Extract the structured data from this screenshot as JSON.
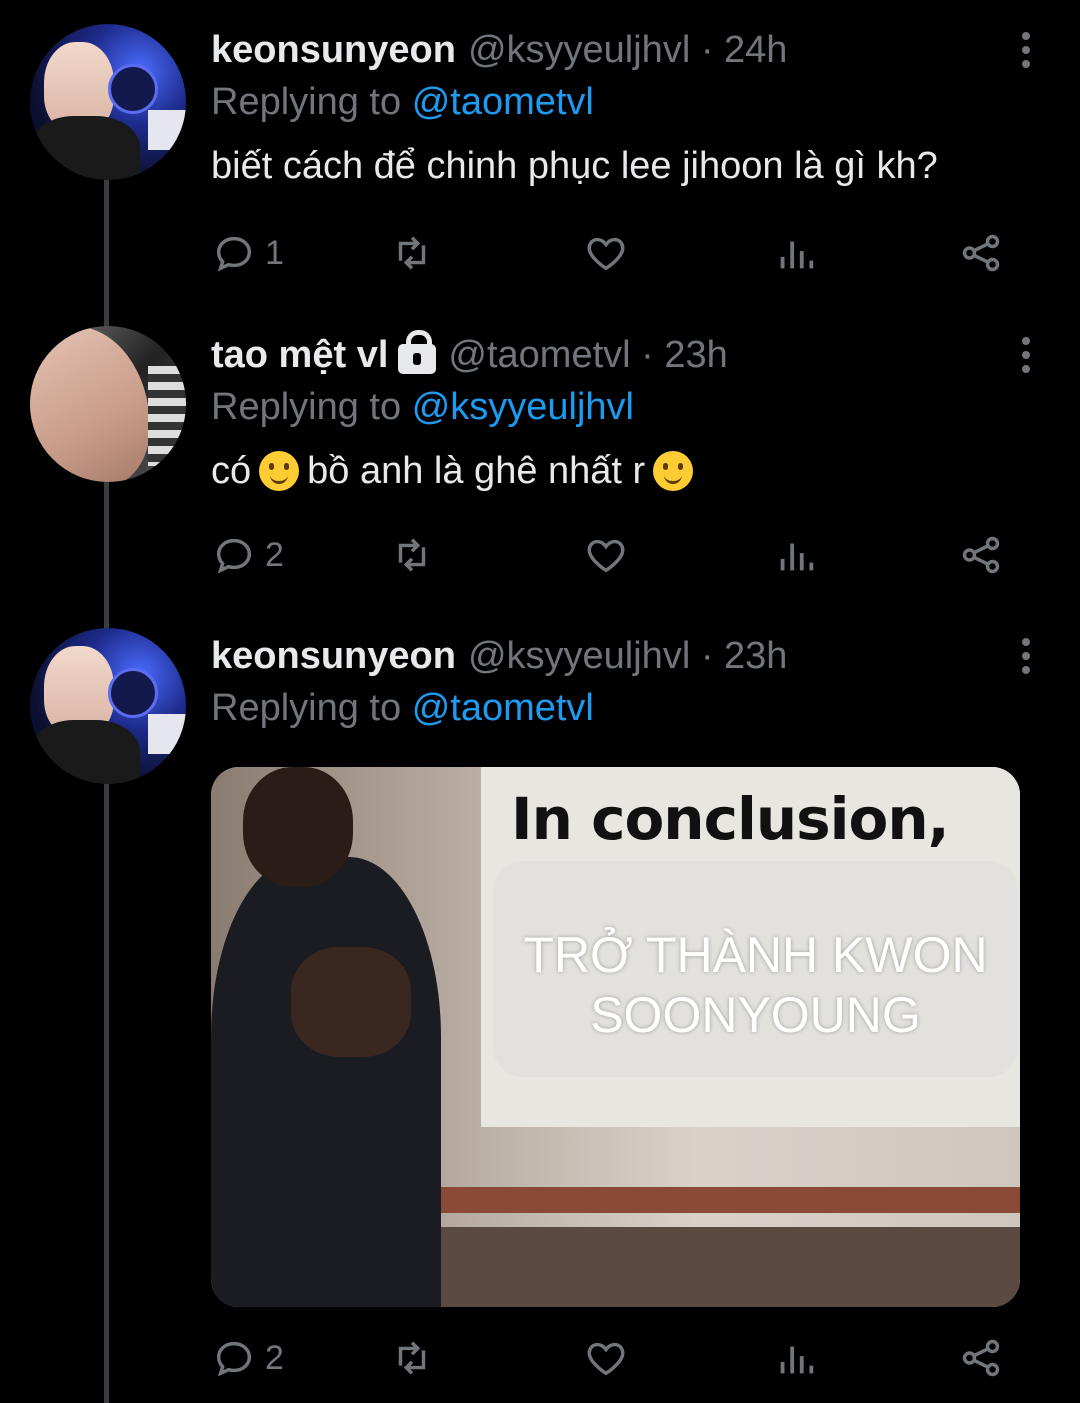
{
  "tweets": [
    {
      "name": "keonsunyeon",
      "handle": "@ksyyeuljhvl · 24h",
      "replying_prefix": "Replying to",
      "replying_to": "@taometvl",
      "text": "biết cách để chinh phục lee jihoon là gì kh?",
      "reply_count": "1"
    },
    {
      "name": "tao mệt vl",
      "handle": "@taometvl · 23h",
      "replying_prefix": "Replying to",
      "replying_to": "@ksyyeuljhvl",
      "text_part1": "có",
      "text_part2": "bồ anh là ghê nhất r",
      "reply_count": "2"
    },
    {
      "name": "keonsunyeon",
      "handle": "@ksyyeuljhvl · 23h",
      "replying_prefix": "Replying to",
      "replying_to": "@taometvl",
      "media": {
        "caption": "In conclusion,",
        "overlay_text": "TRỞ THÀNH KWON SOONYOUNG"
      },
      "reply_count": "2"
    }
  ],
  "icons": [
    "reply-icon",
    "retweet-icon",
    "like-icon",
    "views-icon",
    "share-icon",
    "more-icon",
    "lock-icon",
    "smile-emoji"
  ],
  "colors": {
    "background": "#000000",
    "text": "#e7e9ea",
    "muted": "#71767b",
    "link": "#1d9bf0"
  }
}
